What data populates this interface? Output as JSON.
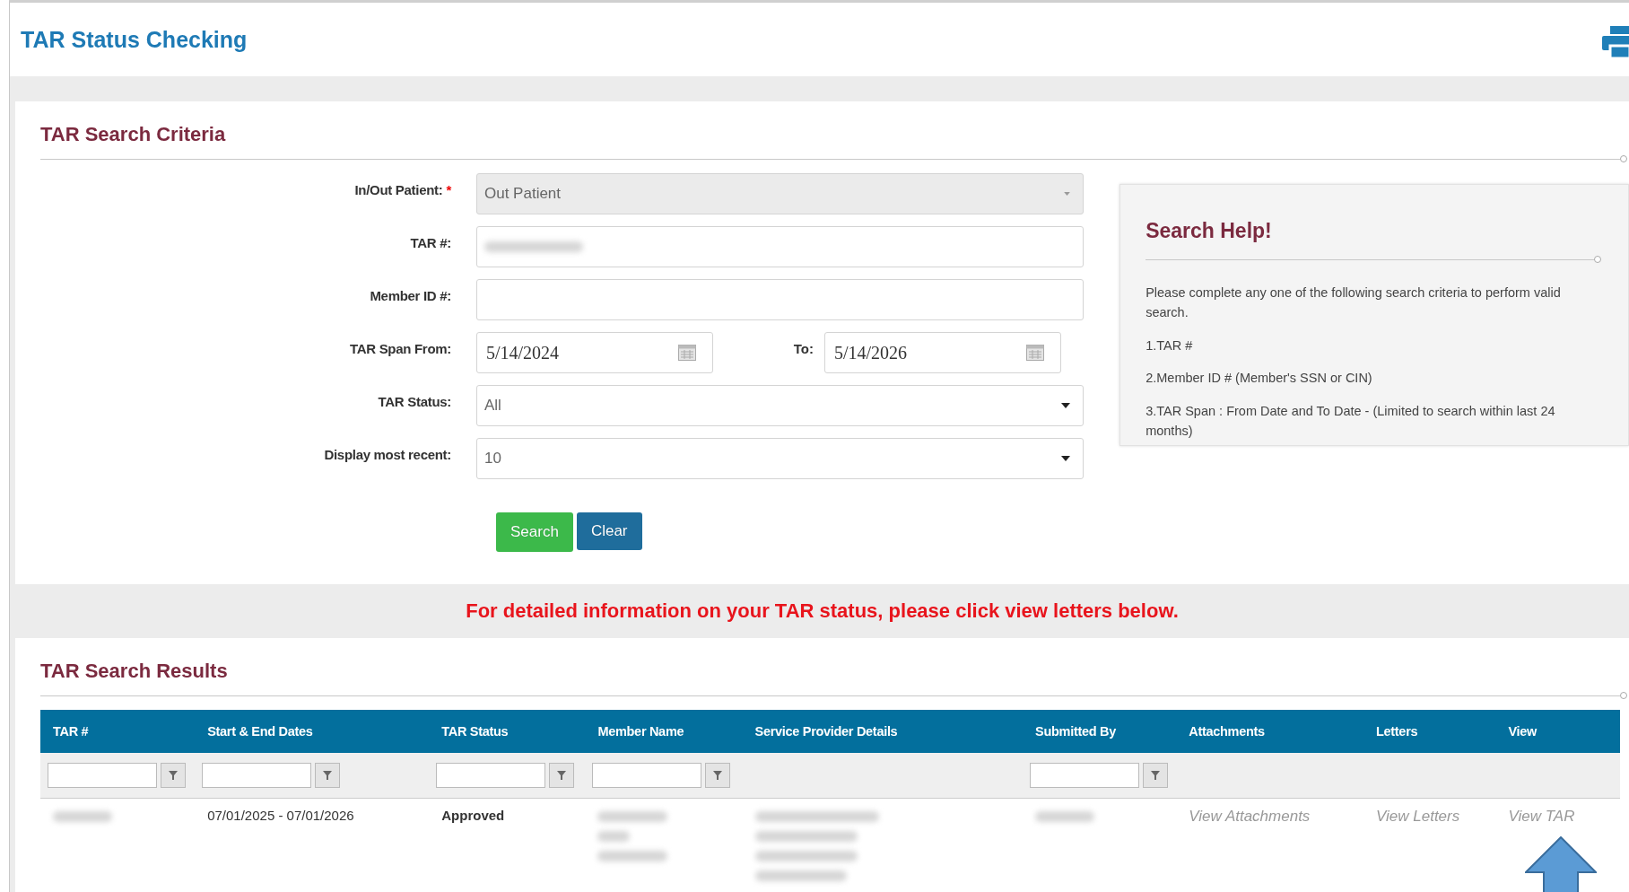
{
  "page": {
    "title": "TAR Status Checking"
  },
  "search_criteria": {
    "heading": "TAR Search Criteria",
    "fields": [
      {
        "kind": "select",
        "label": "In/Out Patient:",
        "required_mark": "*",
        "value": "Out Patient",
        "disabled": true
      },
      {
        "kind": "text",
        "label": "TAR #:",
        "redacted": true
      },
      {
        "kind": "text",
        "label": "Member ID #:",
        "redacted": false
      },
      {
        "kind": "daterange",
        "label": "TAR Span From:",
        "value": "5/14/2024",
        "to_label": "To:",
        "to_value": "5/14/2026"
      },
      {
        "kind": "select",
        "label": "TAR Status:",
        "value": "All",
        "disabled": false
      },
      {
        "kind": "select",
        "label": "Display most recent:",
        "value": "10",
        "disabled": false
      }
    ],
    "buttons": [
      {
        "kind": "primary",
        "label": "Search"
      },
      {
        "kind": "secondary",
        "label": "Clear"
      }
    ]
  },
  "search_help": {
    "title": "Search Help!",
    "intro": "Please complete any one of the following search criteria to perform valid search.",
    "items": [
      "1.TAR #",
      "2.Member ID # (Member's SSN or CIN)",
      "3.TAR Span : From Date and To Date - (Limited to search within last 24 months)"
    ]
  },
  "notice": "For detailed information on your TAR status, please click view letters below.",
  "search_results": {
    "heading": "TAR Search Results",
    "columns": [
      "TAR #",
      "Start & End Dates",
      "TAR Status",
      "Member Name",
      "Service Provider Details",
      "Submitted By",
      "Attachments",
      "Letters",
      "View"
    ],
    "filter_row": [
      {
        "kind": "filter"
      },
      {
        "kind": "filter"
      },
      {
        "kind": "filter"
      },
      {
        "kind": "filter"
      },
      {
        "kind": "none"
      },
      {
        "kind": "filter"
      },
      {
        "kind": "none"
      },
      {
        "kind": "none"
      },
      {
        "kind": "none"
      }
    ],
    "rows": [
      {
        "cells": [
          {
            "kind": "redacted"
          },
          {
            "kind": "text",
            "text": "07/01/2025 - 07/01/2026"
          },
          {
            "kind": "strong",
            "text": "Approved"
          },
          {
            "kind": "redacted"
          },
          {
            "kind": "redacted"
          },
          {
            "kind": "redacted"
          },
          {
            "kind": "link",
            "text": "View Attachments"
          },
          {
            "kind": "link",
            "text": "View Letters"
          },
          {
            "kind": "link",
            "text": "View TAR"
          }
        ]
      }
    ]
  },
  "annotation": {
    "kind": "arrow"
  }
}
